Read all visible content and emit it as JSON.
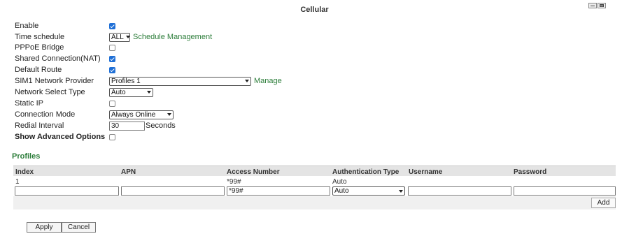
{
  "title": "Cellular",
  "fields": {
    "enable": {
      "label": "Enable",
      "checked": true
    },
    "time_schedule": {
      "label": "Time schedule",
      "value": "ALL",
      "link": "Schedule Management"
    },
    "pppoe_bridge": {
      "label": "PPPoE Bridge",
      "checked": false
    },
    "shared_connection": {
      "label": "Shared Connection(NAT)",
      "checked": true
    },
    "default_route": {
      "label": "Default Route",
      "checked": true
    },
    "sim1_provider": {
      "label": "SIM1 Network Provider",
      "value": "Profiles 1",
      "link": "Manage"
    },
    "network_select_type": {
      "label": "Network Select Type",
      "value": "Auto"
    },
    "static_ip": {
      "label": "Static IP",
      "checked": false
    },
    "connection_mode": {
      "label": "Connection Mode",
      "value": "Always Online"
    },
    "redial_interval": {
      "label": "Redial Interval",
      "value": "30",
      "unit": "Seconds"
    },
    "show_advanced": {
      "label": "Show Advanced Options",
      "checked": false
    }
  },
  "profiles": {
    "title": "Profiles",
    "columns": [
      "Index",
      "APN",
      "Access Number",
      "Authentication Type",
      "Username",
      "Password"
    ],
    "rows": [
      [
        "1",
        "",
        "*99#",
        "Auto",
        "",
        ""
      ]
    ],
    "new_row": {
      "index": "",
      "apn": "",
      "access_number": "*99#",
      "auth_type": "Auto",
      "username": "",
      "password": ""
    },
    "add_label": "Add"
  },
  "actions": {
    "apply": "Apply",
    "cancel": "Cancel"
  },
  "colors": {
    "link": "#2c7d3a",
    "checkbox": "#1f6fd6"
  }
}
